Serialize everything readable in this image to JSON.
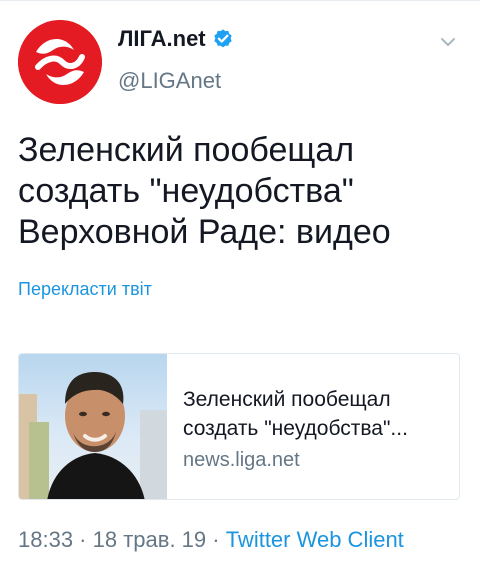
{
  "account": {
    "display_name": "ЛІГА.net",
    "handle": "@LIGAnet",
    "verified": true,
    "avatar_icon": "liga-logo-icon",
    "brand_color": "#e51b24",
    "verified_color": "#1da1f2"
  },
  "tweet": {
    "text": "Зеленский пообещал\nсоздать \"неудобства\"\nВерховной Раде: видео",
    "translate_label": "Перекласти твіт"
  },
  "card": {
    "title": "Зеленский пообещал\nсоздать \"неудобства\"...",
    "domain": "news.liga.net",
    "image_icon": "man-portrait-thumbnail"
  },
  "footer": {
    "time": "18:33",
    "separator_1": " · ",
    "date": "18 трав. 19",
    "separator_2": " · ",
    "client": "Twitter Web Client"
  },
  "icons": {
    "menu": "chevron-down-icon",
    "verified": "verified-badge-icon"
  },
  "colors": {
    "text_primary": "#141823",
    "text_secondary": "#657786",
    "link": "#1b95e0",
    "border": "#e1e8ed"
  }
}
